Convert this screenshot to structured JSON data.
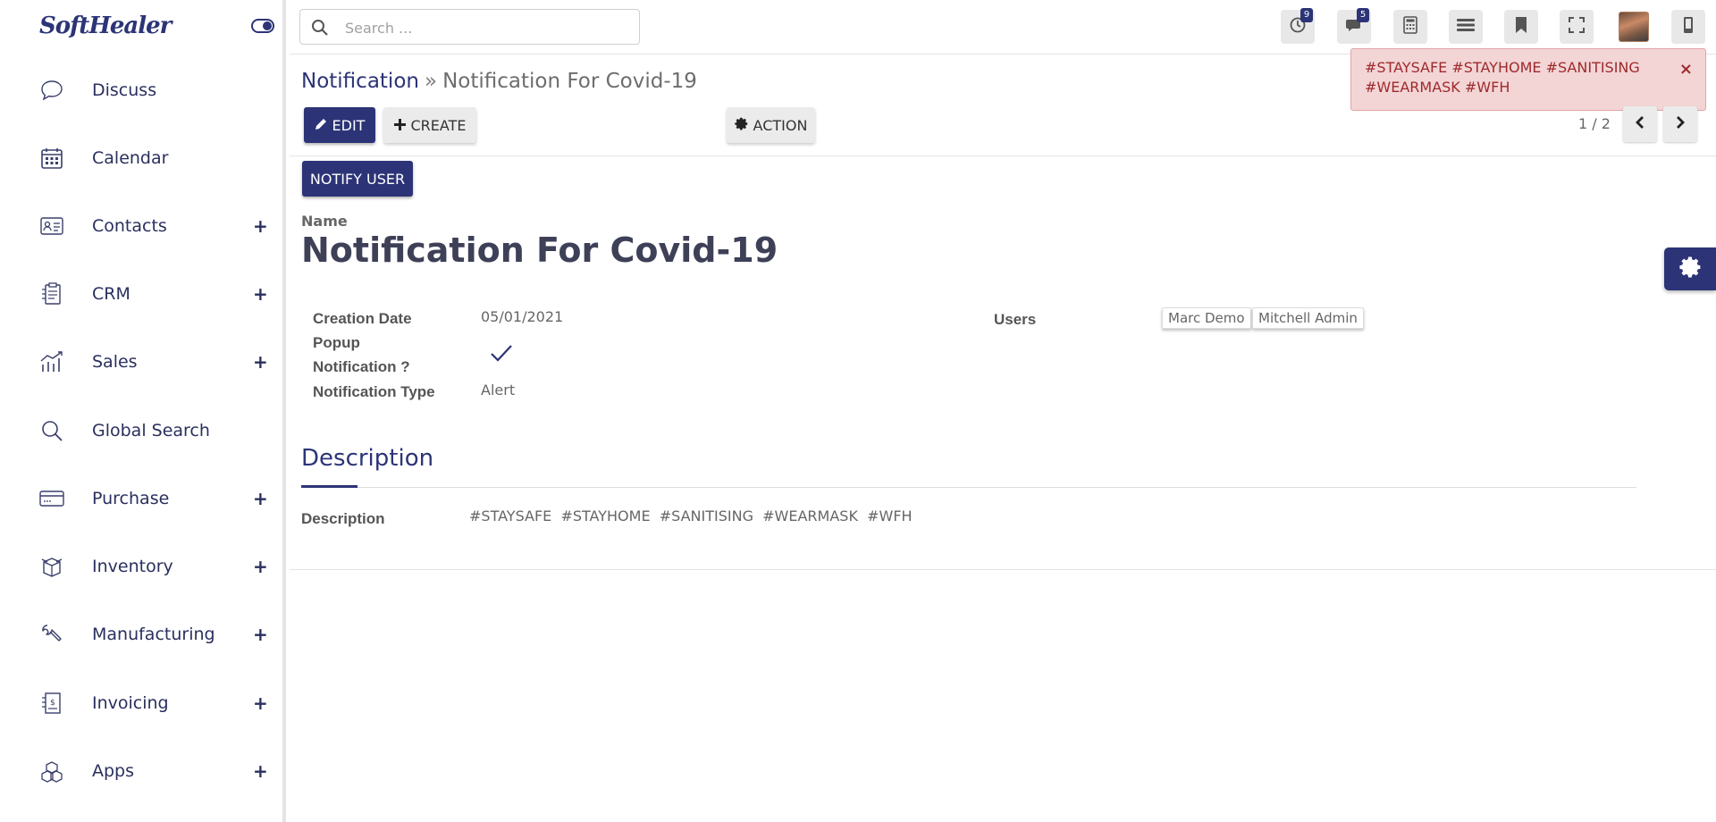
{
  "brand": {
    "logo_text": "SoftHealer"
  },
  "sidebar": {
    "items": [
      {
        "label": "Discuss",
        "icon": "chat-bubble-icon",
        "has_plus": false
      },
      {
        "label": "Calendar",
        "icon": "calendar-icon",
        "has_plus": false
      },
      {
        "label": "Contacts",
        "icon": "contact-card-icon",
        "has_plus": true
      },
      {
        "label": "CRM",
        "icon": "crm-clipboard-icon",
        "has_plus": true
      },
      {
        "label": "Sales",
        "icon": "sales-chart-icon",
        "has_plus": true
      },
      {
        "label": "Global Search",
        "icon": "search-icon",
        "has_plus": false
      },
      {
        "label": "Purchase",
        "icon": "credit-card-icon",
        "has_plus": true
      },
      {
        "label": "Inventory",
        "icon": "box-icon",
        "has_plus": true
      },
      {
        "label": "Manufacturing",
        "icon": "wrench-icon",
        "has_plus": true
      },
      {
        "label": "Invoicing",
        "icon": "invoice-icon",
        "has_plus": true
      },
      {
        "label": "Apps",
        "icon": "apps-icon",
        "has_plus": true
      }
    ],
    "plus_symbol": "+"
  },
  "topbar": {
    "search_placeholder": "Search ...",
    "activity_badge": "9",
    "messages_badge": "5"
  },
  "breadcrumb": {
    "parent": "Notification",
    "separator": "»",
    "current": "Notification For Covid-19"
  },
  "toolbar": {
    "edit_label": "EDIT",
    "create_label": "CREATE",
    "action_label": "ACTION"
  },
  "pager": {
    "value": "1 / 2"
  },
  "toast": {
    "message": "#STAYSAFE #STAYHOME #SANITISING #WEARMASK #WFH",
    "close": "×"
  },
  "form": {
    "notify_button": "NOTIFY USER",
    "name_label": "Name",
    "name_value": "Notification For Covid-19",
    "creation_date_label": "Creation Date",
    "creation_date_value": "05/01/2021",
    "popup_label_line1": "Popup",
    "popup_label_line2": "Notification ?",
    "popup_checked": true,
    "type_label": "Notification Type",
    "type_value": "Alert",
    "users_label": "Users",
    "users": [
      "Marc Demo",
      "Mitchell Admin"
    ],
    "tab_title": "Description",
    "description_label": "Description",
    "description_value": "#STAYSAFE  #STAYHOME  #SANITISING  #WEARMASK  #WFH"
  },
  "colors": {
    "brand": "#2c3477",
    "toast_bg": "#f3d5d6",
    "toast_text": "#9e2a2c"
  }
}
